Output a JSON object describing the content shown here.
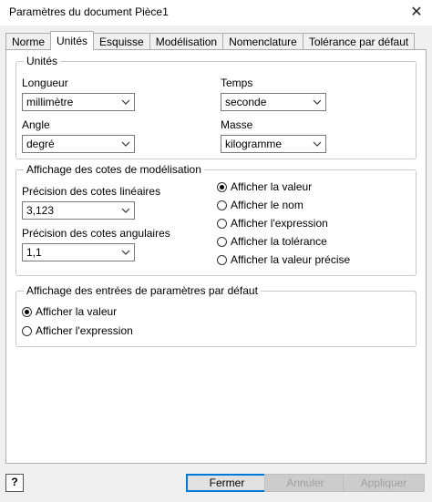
{
  "window": {
    "title": "Paramètres du document Pièce1",
    "close_glyph": "✕"
  },
  "tabs": [
    {
      "label": "Norme",
      "active": false
    },
    {
      "label": "Unités",
      "active": true
    },
    {
      "label": "Esquisse",
      "active": false
    },
    {
      "label": "Modélisation",
      "active": false
    },
    {
      "label": "Nomenclature",
      "active": false
    },
    {
      "label": "Tolérance par défaut",
      "active": false
    }
  ],
  "units": {
    "title": "Unités",
    "length": {
      "label": "Longueur",
      "value": "millimètre"
    },
    "time": {
      "label": "Temps",
      "value": "seconde"
    },
    "angle": {
      "label": "Angle",
      "value": "degré"
    },
    "mass": {
      "label": "Masse",
      "value": "kilogramme"
    }
  },
  "model_dims": {
    "title": "Affichage des cotes de modélisation",
    "linear_precision": {
      "label": "Précision des cotes linéaires",
      "value": "3,123"
    },
    "angular_precision": {
      "label": "Précision des cotes angulaires",
      "value": "1,1"
    },
    "options": [
      {
        "label": "Afficher la valeur",
        "checked": true
      },
      {
        "label": "Afficher le nom",
        "checked": false
      },
      {
        "label": "Afficher l'expression",
        "checked": false
      },
      {
        "label": "Afficher la tolérance",
        "checked": false
      },
      {
        "label": "Afficher la valeur précise",
        "checked": false
      }
    ]
  },
  "param_entries": {
    "title": "Affichage des entrées de paramètres par défaut",
    "options": [
      {
        "label": "Afficher la valeur",
        "checked": true
      },
      {
        "label": "Afficher l'expression",
        "checked": false
      }
    ]
  },
  "buttons": {
    "help": "?",
    "close": "Fermer",
    "cancel": "Annuler",
    "apply": "Appliquer"
  }
}
